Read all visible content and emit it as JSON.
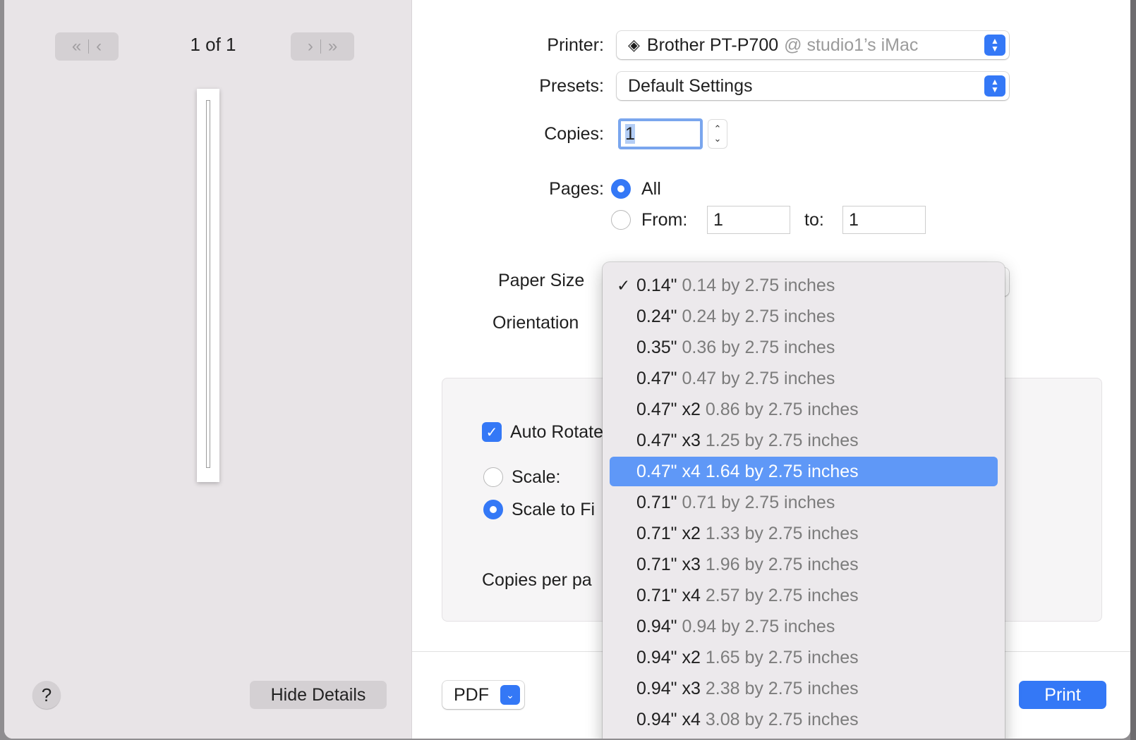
{
  "preview": {
    "page_count": "1 of 1",
    "help_label": "?",
    "hide_details_label": "Hide Details"
  },
  "printer": {
    "label": "Printer:",
    "name": "Brother PT-P700",
    "host": "@ studio1’s iMac"
  },
  "presets": {
    "label": "Presets:",
    "value": "Default Settings"
  },
  "copies": {
    "label": "Copies:",
    "value": "1"
  },
  "pages": {
    "label": "Pages:",
    "all_label": "All",
    "from_label": "From:",
    "from_value": "1",
    "to_label": "to:",
    "to_value": "1",
    "selected": "all"
  },
  "paper_size": {
    "label": "Paper Size",
    "options": [
      {
        "name": "0.14\"",
        "desc": "0.14 by 2.75 inches",
        "checked": true
      },
      {
        "name": "0.24\"",
        "desc": "0.24 by 2.75 inches"
      },
      {
        "name": "0.35\"",
        "desc": "0.36 by 2.75 inches"
      },
      {
        "name": "0.47\"",
        "desc": "0.47 by 2.75 inches"
      },
      {
        "name": "0.47\" x2",
        "desc": "0.86 by 2.75 inches"
      },
      {
        "name": "0.47\" x3",
        "desc": "1.25 by 2.75 inches"
      },
      {
        "name": "0.47\" x4",
        "desc": "1.64 by 2.75 inches",
        "highlighted": true
      },
      {
        "name": "0.71\"",
        "desc": "0.71 by 2.75 inches"
      },
      {
        "name": "0.71\" x2",
        "desc": "1.33 by 2.75 inches"
      },
      {
        "name": "0.71\" x3",
        "desc": "1.96 by 2.75 inches"
      },
      {
        "name": "0.71\" x4",
        "desc": "2.57 by 2.75 inches"
      },
      {
        "name": "0.94\"",
        "desc": "0.94 by 2.75 inches"
      },
      {
        "name": "0.94\" x2",
        "desc": "1.65 by 2.75 inches"
      },
      {
        "name": "0.94\" x3",
        "desc": "2.38 by 2.75 inches"
      },
      {
        "name": "0.94\" x4",
        "desc": "3.08 by 2.75 inches"
      }
    ]
  },
  "orientation": {
    "label": "Orientation"
  },
  "layout_box": {
    "auto_rotate_label": "Auto Rotate",
    "scale_label": "Scale:",
    "scale_to_fit_label": "Scale to Fi",
    "copies_per_page_label": "Copies per pa"
  },
  "footer": {
    "pdf_label": "PDF",
    "print_label": "Print"
  },
  "colors": {
    "accent": "#3478f6",
    "menu_highlight": "#5f98f7"
  }
}
